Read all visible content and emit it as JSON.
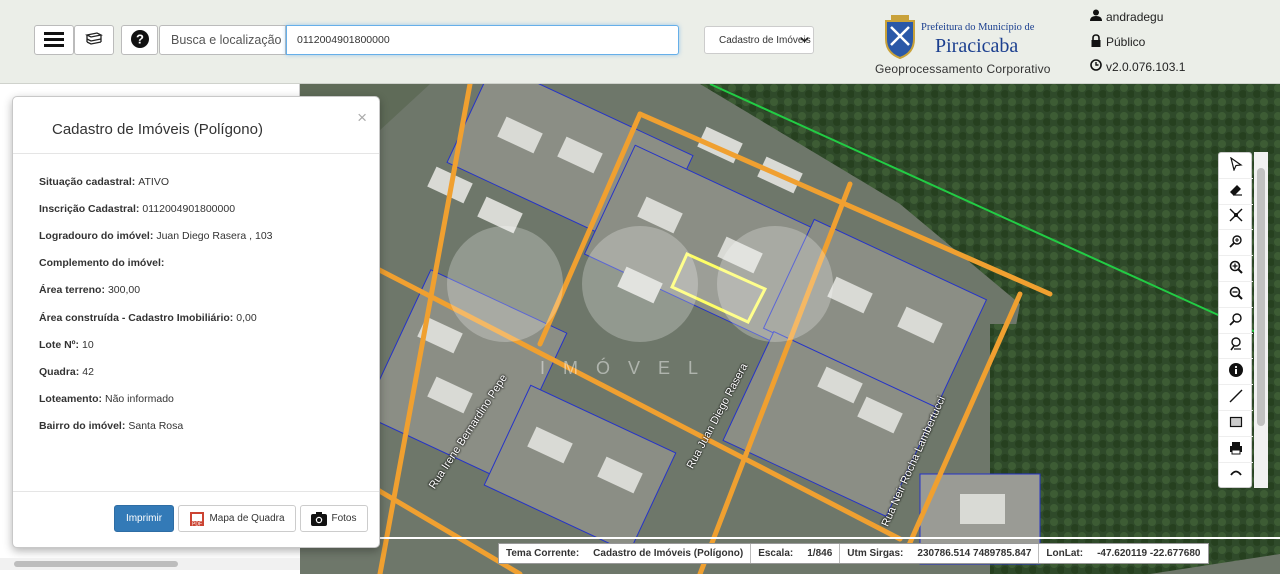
{
  "topbar": {
    "menu_icon": "hamburger-icon",
    "layers_icon": "layers-icon",
    "help_icon": "help-icon",
    "search_label": "Busca e localização",
    "search_value": "0112004901800000",
    "layer_select_value": "Cadastro de Imóveis"
  },
  "logo": {
    "prefeitura": "Prefeitura do Município de",
    "city": "Piracicaba",
    "subtitle": "Geoprocessamento Corporativo"
  },
  "user": {
    "username": "andradegu",
    "access": "Público",
    "version": "v2.0.076.103.1"
  },
  "modal": {
    "title": "Cadastro de Imóveis (Polígono)",
    "close": "×",
    "fields": [
      {
        "label": "Situação cadastral:",
        "value": "ATIVO"
      },
      {
        "label": "Inscrição Cadastral:",
        "value": "0112004901800000"
      },
      {
        "label": "Logradouro do imóvel:",
        "value": "Juan Diego Rasera , 103"
      },
      {
        "label": "Complemento do imóvel:",
        "value": ""
      },
      {
        "label": "Área terreno:",
        "value": "300,00"
      },
      {
        "label": "Área construída - Cadastro Imobiliário:",
        "value": "0,00"
      },
      {
        "label": "Lote Nº:",
        "value": "10"
      },
      {
        "label": "Quadra:",
        "value": "42"
      },
      {
        "label": "Loteamento:",
        "value": "Não informado"
      },
      {
        "label": "Bairro do imóvel:",
        "value": "Santa Rosa"
      }
    ],
    "buttons": {
      "print": "Imprimir",
      "block_map": "Mapa de Quadra",
      "photos": "Fotos"
    }
  },
  "map": {
    "streets": [
      "Rua Irene Bernardino Pepe",
      "Rua Juan Diego Rasera",
      "Rua Neir Rocha Lambertucci"
    ],
    "watermark": "IMÓVEL"
  },
  "status": {
    "theme_label": "Tema Corrente:",
    "theme_value": "Cadastro de Imóveis (Polígono)",
    "scale_label": "Escala:",
    "scale_value": "1/846",
    "utm_label": "Utm Sirgas:",
    "utm_value": "230786.514 7489785.847",
    "lonlat_label": "LonLat:",
    "lonlat_value": "-47.620119 -22.677680"
  },
  "colors": {
    "primary": "#337ab7",
    "selected_lot": "#ffff66",
    "roads": "#f0a030",
    "parcels": "#1a2bd0",
    "boundary": "#22cc44"
  }
}
